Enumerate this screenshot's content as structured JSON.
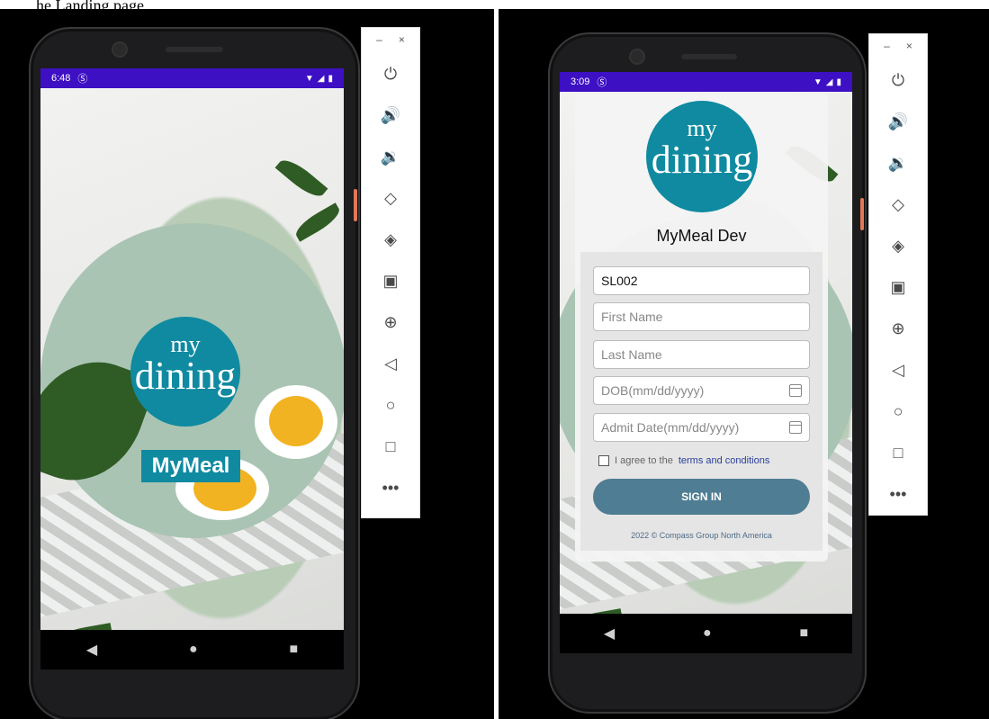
{
  "caption": "he Landing page",
  "left_phone": {
    "status": {
      "time": "6:48",
      "notif": "Ⓢ"
    },
    "logo": {
      "my": "my",
      "dining": "dining"
    },
    "badge": "MyMeal",
    "nav": {
      "back": "◀",
      "home": "●",
      "recents": "■"
    }
  },
  "right_phone": {
    "status": {
      "time": "3:09",
      "notif": "Ⓢ"
    },
    "logo": {
      "my": "my",
      "dining": "dining"
    },
    "app_title": "MyMeal Dev",
    "form": {
      "site_code": "SL002",
      "first_name_placeholder": "First Name",
      "last_name_placeholder": "Last Name",
      "dob_placeholder": "DOB(mm/dd/yyyy)",
      "admit_placeholder": "Admit Date(mm/dd/yyyy)"
    },
    "terms_text": "I agree to the",
    "terms_link": "terms and conditions",
    "signin": "SIGN IN",
    "copyright": "2022 © Compass Group North America",
    "nav": {
      "back": "◀",
      "home": "●",
      "recents": "■"
    }
  },
  "emulator_toolbar": {
    "minimize": "–",
    "close": "×",
    "tools": [
      {
        "name": "power-icon",
        "glyph": "⏻"
      },
      {
        "name": "volume-up-icon",
        "glyph": "🔊"
      },
      {
        "name": "volume-down-icon",
        "glyph": "🔉"
      },
      {
        "name": "rotate-left-icon",
        "glyph": "◇"
      },
      {
        "name": "rotate-right-icon",
        "glyph": "◈"
      },
      {
        "name": "camera-icon",
        "glyph": "▣"
      },
      {
        "name": "zoom-icon",
        "glyph": "⊕"
      },
      {
        "name": "back-icon",
        "glyph": "◁"
      },
      {
        "name": "home-icon",
        "glyph": "○"
      },
      {
        "name": "overview-icon",
        "glyph": "□"
      },
      {
        "name": "more-icon",
        "glyph": "•••"
      }
    ]
  },
  "colors": {
    "status_bar": "#3d10c4",
    "brand": "#0f8aa0",
    "signin": "#4f7d93"
  }
}
